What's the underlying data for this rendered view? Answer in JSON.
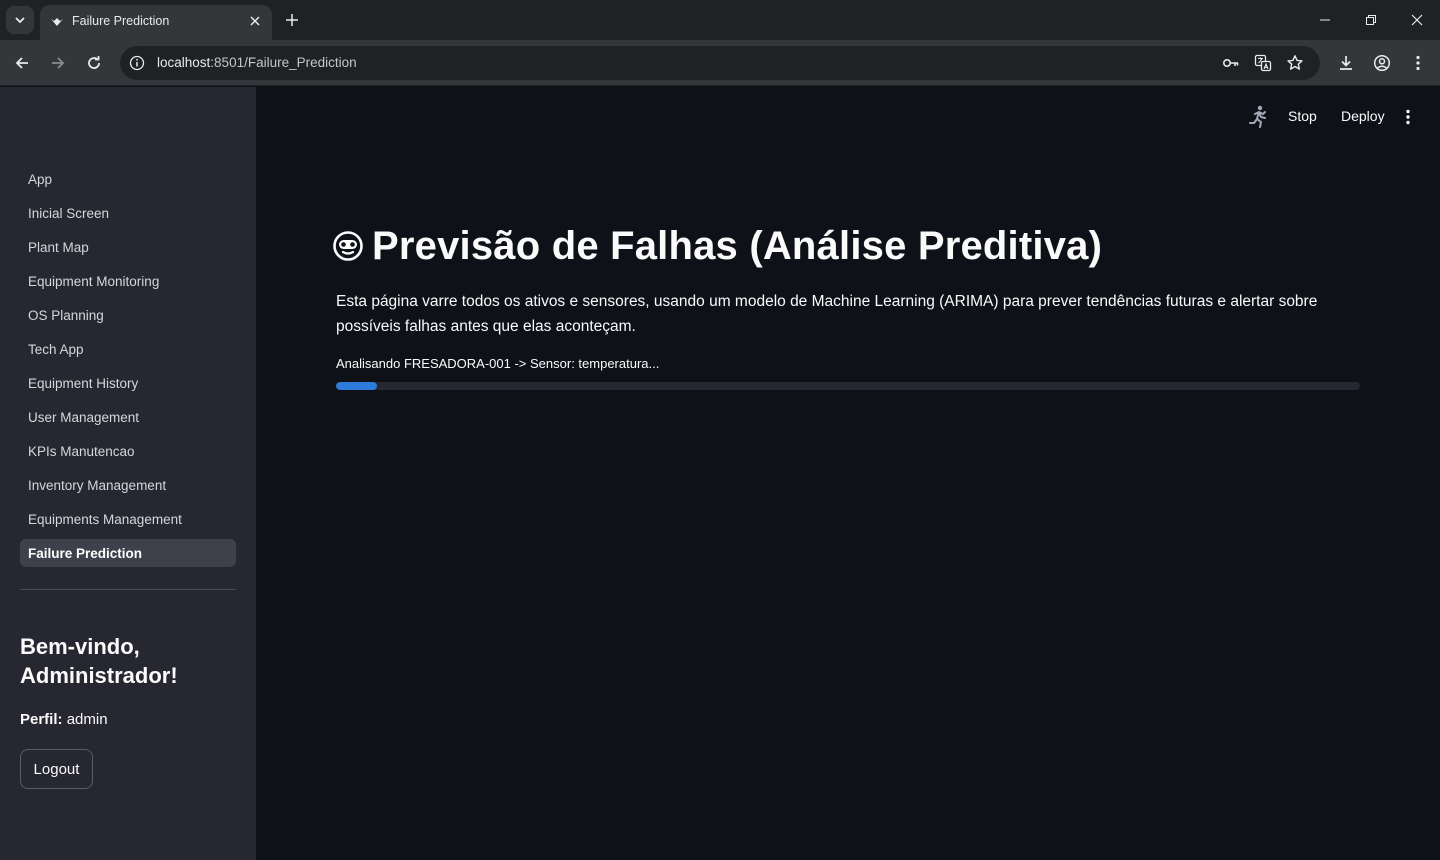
{
  "browser": {
    "tab_title": "Failure Prediction",
    "url_host": "localhost",
    "url_rest": ":8501/Failure_Prediction"
  },
  "app_header": {
    "stop_label": "Stop",
    "deploy_label": "Deploy"
  },
  "sidebar": {
    "items": [
      {
        "label": "App"
      },
      {
        "label": "Inicial Screen"
      },
      {
        "label": "Plant Map"
      },
      {
        "label": "Equipment Monitoring"
      },
      {
        "label": "OS Planning"
      },
      {
        "label": "Tech App"
      },
      {
        "label": "Equipment History"
      },
      {
        "label": "User Management"
      },
      {
        "label": "KPIs Manutencao"
      },
      {
        "label": "Inventory Management"
      },
      {
        "label": "Equipments Management"
      },
      {
        "label": "Failure Prediction",
        "active": true
      }
    ],
    "welcome": "Bem-vindo, Administrador!",
    "profile_label": "Perfil:",
    "profile_value": "admin",
    "logout_label": "Logout"
  },
  "main": {
    "title": "Previsão de Falhas (Análise Preditiva)",
    "description": "Esta página varre todos os ativos e sensores, usando um modelo de Machine Learning (ARIMA) para prever tendências futuras e alertar sobre possíveis falhas antes que elas aconteçam.",
    "progress_text": "Analisando FRESADORA-001 -> Sensor: temperatura...",
    "progress_fraction": 0.04
  },
  "colors": {
    "accent": "#2f7bdc",
    "sidebar_bg": "#262730",
    "main_bg": "#0e1117"
  }
}
